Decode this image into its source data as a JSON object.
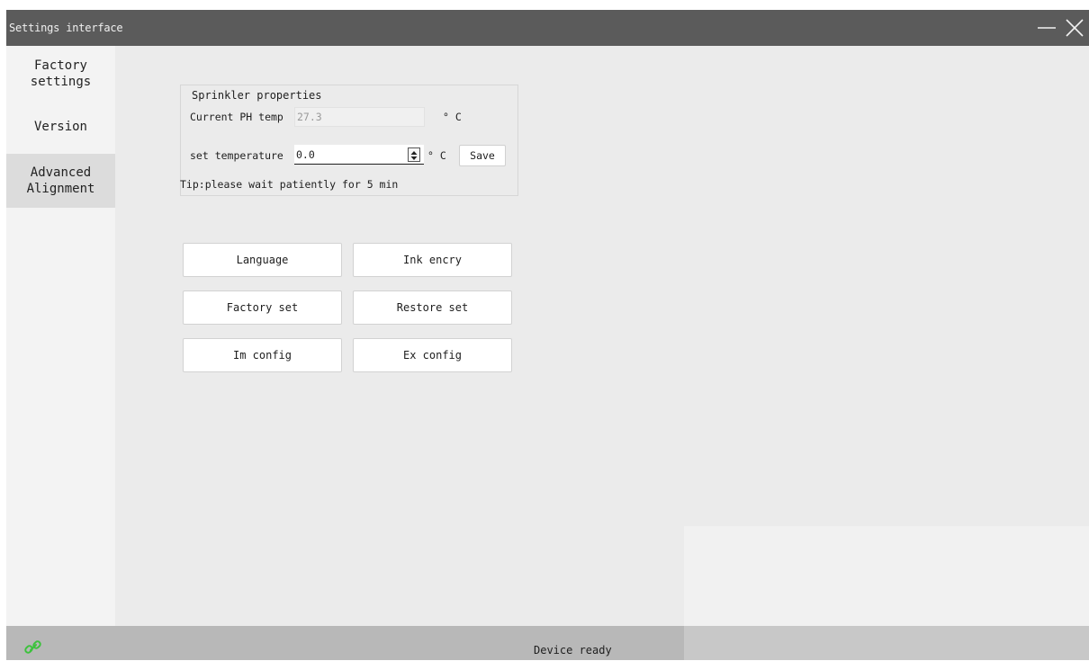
{
  "window": {
    "title": "Settings interface",
    "minimize_icon": "minimize-icon",
    "close_icon": "close-icon"
  },
  "sidebar": {
    "items": [
      {
        "label": "Factory\nsettings",
        "selected": false
      },
      {
        "label": "Version",
        "selected": false
      },
      {
        "label": "Advanced\nAlignment",
        "selected": true
      }
    ]
  },
  "sprinkler": {
    "group_title": "Sprinkler properties",
    "current_temp_label": "Current PH temp",
    "current_temp_value": "27.3",
    "current_temp_unit": "° C",
    "set_temp_label": "set temperature",
    "set_temp_value": "0.0",
    "set_temp_unit": "° C",
    "save_label": "Save",
    "tip": "Tip:please wait patiently for 5 min"
  },
  "actions": {
    "language": "Language",
    "ink_encry": "Ink encry",
    "factory_set": "Factory set",
    "restore_set": "Restore set",
    "im_config": "Im config",
    "ex_config": "Ex config"
  },
  "status": {
    "text": "Device ready",
    "link_icon": "link-icon",
    "link_color": "#3cc23c"
  }
}
